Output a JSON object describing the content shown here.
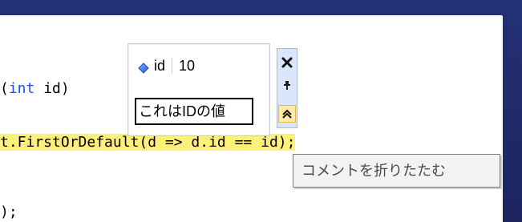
{
  "editor": {
    "lines": [
      {
        "prefix": "(",
        "keyword": "int",
        "suffix": " id)"
      },
      {
        "text": "t.FirstOrDefault(d => d.id == id);"
      },
      {
        "text": ");"
      }
    ]
  },
  "datatip": {
    "name": "id",
    "value": "10",
    "comment": "これはIDの値",
    "buttons": {
      "close_icon": "close-icon",
      "pin_icon": "pin-icon",
      "collapse_icon": "double-chevron-up-icon"
    }
  },
  "tooltip": {
    "text": "コメントを折りたたむ"
  },
  "colors": {
    "frame": "#1f2a66",
    "keyword": "#1f4bff",
    "highlight": "#fff07a",
    "datatip_buttons_bg": "#d9e6fb",
    "collapse_button_bg": "#ffeaa6",
    "tooltip_bg": "#f3f3f3"
  }
}
